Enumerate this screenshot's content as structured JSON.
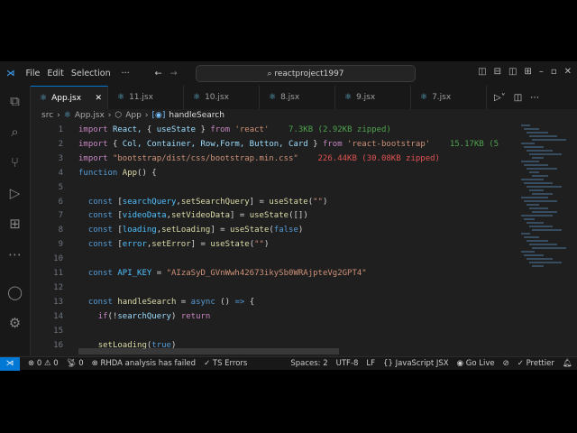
{
  "titlebar": {
    "menu": [
      "File",
      "Edit",
      "Selection",
      "···"
    ],
    "search": "reactproject1997"
  },
  "tabs": [
    {
      "label": "App.jsx",
      "active": true
    },
    {
      "label": "11.jsx"
    },
    {
      "label": "10.jsx"
    },
    {
      "label": "8.jsx"
    },
    {
      "label": "9.jsx"
    },
    {
      "label": "7.jsx"
    }
  ],
  "breadcrumb": [
    "src",
    "App.jsx",
    "App",
    "handleSearch"
  ],
  "code": [
    {
      "n": "1",
      "t": [
        [
          "kw",
          "import "
        ],
        [
          "va",
          "React"
        ],
        [
          "",
          "{ "
        ],
        [
          "va",
          "useState"
        ],
        [
          "",
          "",
          " } "
        ],
        [
          "kw",
          "from "
        ],
        [
          "st",
          "'react'"
        ],
        [
          "sz",
          "    7.3KB (2.92KB zipped)"
        ]
      ]
    },
    {
      "n": "2",
      "t": [
        [
          "kw",
          "import "
        ],
        [
          "",
          "{ "
        ],
        [
          "va",
          "Col, Container, Row,Form, Button, Card"
        ],
        [
          "",
          " } "
        ],
        [
          "kw",
          "from "
        ],
        [
          "st",
          "'react-bootstrap'"
        ],
        [
          "sz",
          "    15.17KB (5"
        ]
      ]
    },
    {
      "n": "3",
      "t": [
        [
          "kw",
          "import "
        ],
        [
          "st",
          "\"bootstrap/dist/css/bootstrap.min.css\""
        ],
        [
          "szr",
          "    226.44KB (30.08KB zipped)"
        ]
      ]
    },
    {
      "n": "4",
      "t": [
        [
          "kb",
          "function "
        ],
        [
          "fn",
          "App"
        ],
        [
          "",
          "() {"
        ]
      ]
    },
    {
      "n": "5",
      "t": []
    },
    {
      "n": "6",
      "t": [
        [
          "",
          "  "
        ],
        [
          "kb",
          "const "
        ],
        [
          "",
          "["
        ],
        [
          "co",
          "searchQuery"
        ],
        [
          "",
          ","
        ],
        [
          "fn",
          "setSearchQuery"
        ],
        [
          "",
          "] = "
        ],
        [
          "fn",
          "useState"
        ],
        [
          "",
          "("
        ],
        [
          "st",
          "\"\""
        ],
        [
          "",
          ")"
        ]
      ]
    },
    {
      "n": "7",
      "t": [
        [
          "",
          "  "
        ],
        [
          "kb",
          "const "
        ],
        [
          "",
          "["
        ],
        [
          "co",
          "videoData"
        ],
        [
          "",
          ","
        ],
        [
          "fn",
          "setVideoData"
        ],
        [
          "",
          "] = "
        ],
        [
          "fn",
          "useState"
        ],
        [
          "",
          "([])"
        ]
      ]
    },
    {
      "n": "8",
      "t": [
        [
          "",
          "  "
        ],
        [
          "kb",
          "const "
        ],
        [
          "",
          "["
        ],
        [
          "co",
          "loading"
        ],
        [
          "",
          ","
        ],
        [
          "fn",
          "setLoading"
        ],
        [
          "",
          "] = "
        ],
        [
          "fn",
          "useState"
        ],
        [
          "",
          "("
        ],
        [
          "kb",
          "false"
        ],
        [
          "",
          ")"
        ]
      ]
    },
    {
      "n": "9",
      "t": [
        [
          "",
          "  "
        ],
        [
          "kb",
          "const "
        ],
        [
          "",
          "["
        ],
        [
          "co",
          "error"
        ],
        [
          "",
          ","
        ],
        [
          "fn",
          "setError"
        ],
        [
          "",
          "] = "
        ],
        [
          "fn",
          "useState"
        ],
        [
          "",
          "("
        ],
        [
          "st",
          "\"\""
        ],
        [
          "",
          ")"
        ]
      ]
    },
    {
      "n": "10",
      "t": []
    },
    {
      "n": "11",
      "t": [
        [
          "",
          "  "
        ],
        [
          "kb",
          "const "
        ],
        [
          "co",
          "API_KEY"
        ],
        [
          "",
          " = "
        ],
        [
          "st",
          "\"AIzaSyD_GVnWwh42673ikySb0WRAjpteVg2GPT4\""
        ]
      ]
    },
    {
      "n": "12",
      "t": []
    },
    {
      "n": "13",
      "t": [
        [
          "",
          "  "
        ],
        [
          "kb",
          "const "
        ],
        [
          "fn",
          "handleSearch"
        ],
        [
          "",
          " = "
        ],
        [
          "kb",
          "async "
        ],
        [
          "",
          "() "
        ],
        [
          "kb",
          "=> "
        ],
        [
          "",
          "{"
        ]
      ]
    },
    {
      "n": "14",
      "t": [
        [
          "",
          "    "
        ],
        [
          "kw",
          "if"
        ],
        [
          "",
          "(!"
        ],
        [
          "va",
          "searchQuery"
        ],
        [
          "",
          ") "
        ],
        [
          "kw",
          "return"
        ]
      ]
    },
    {
      "n": "15",
      "t": []
    },
    {
      "n": "16",
      "t": [
        [
          "",
          "    "
        ],
        [
          "fn",
          "setLoading"
        ],
        [
          "",
          "("
        ],
        [
          "kb",
          "true"
        ],
        [
          "",
          ")"
        ]
      ]
    }
  ],
  "status": {
    "errors": "0",
    "warnings": "0",
    "ports": "0",
    "rhda": "RHDA analysis has failed",
    "ts": "TS Errors",
    "spaces": "Spaces: 2",
    "encoding": "UTF-8",
    "eol": "LF",
    "lang": "JavaScript JSX",
    "golive": "Go Live",
    "prettier": "Prettier"
  }
}
